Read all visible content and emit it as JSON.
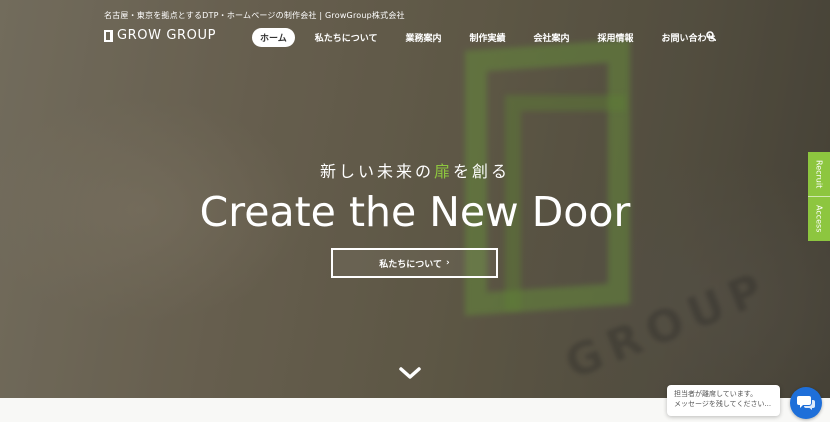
{
  "header": {
    "tagline": "名古屋・東京を拠点とするDTP・ホームページの制作会社 | GrowGroup株式会社",
    "logo_text": "GROW GROUP"
  },
  "nav": {
    "items": [
      {
        "label": "ホーム",
        "active": true
      },
      {
        "label": "私たちについて"
      },
      {
        "label": "業務案内"
      },
      {
        "label": "制作実績"
      },
      {
        "label": "会社案内"
      },
      {
        "label": "採用情報"
      },
      {
        "label": "お問い合わせ"
      }
    ],
    "search_icon": "search-icon"
  },
  "hero": {
    "subtitle_before": "新しい未来の",
    "subtitle_accent": "扉",
    "subtitle_after": "を創る",
    "title": "Create the New Door",
    "cta_label": "私たちについて",
    "cta_chevron": "›",
    "background_wall_text": "GROUP"
  },
  "side_tabs": {
    "recruit": "Recruit",
    "access": "Access"
  },
  "chat": {
    "line1": "担当者が離席しています。",
    "line2": "メッセージを残してください..."
  },
  "colors": {
    "accent": "#8dc63f",
    "chat_blue": "#1e6fd9"
  }
}
